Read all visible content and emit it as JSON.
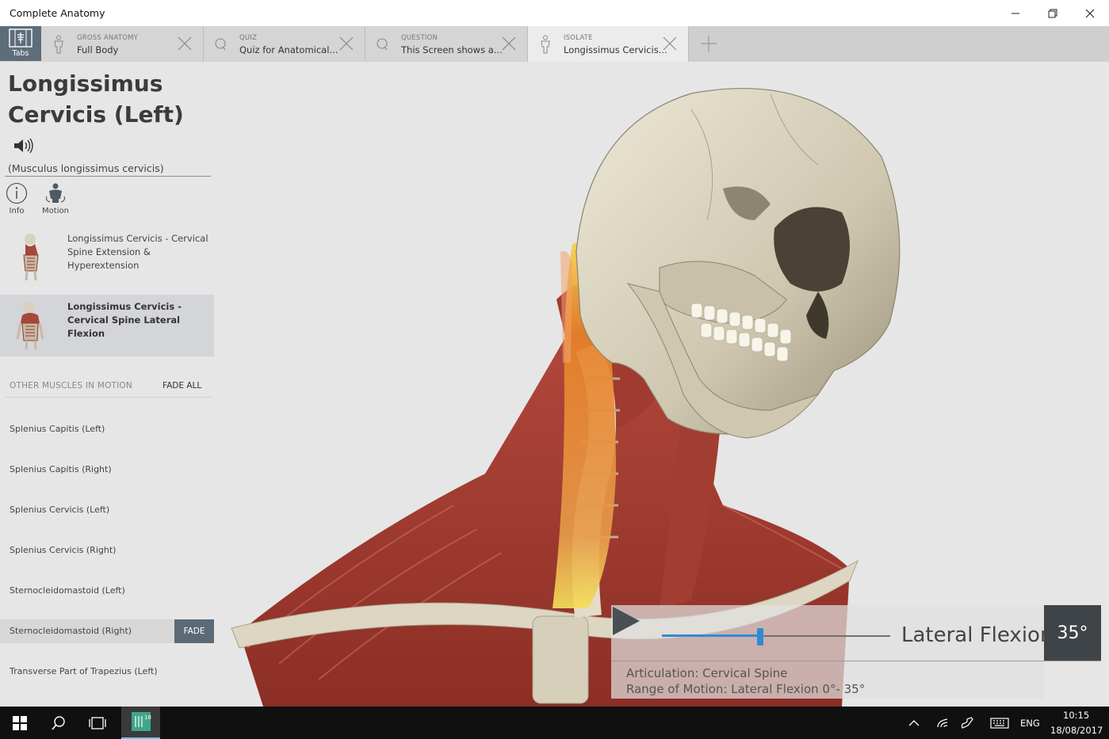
{
  "window": {
    "title": "Complete Anatomy"
  },
  "tabstrip": {
    "tabs_button_label": "Tabs",
    "tabs": [
      {
        "kind": "GROSS ANATOMY",
        "name": "Full Body",
        "icon": "person-icon",
        "active": false
      },
      {
        "kind": "QUIZ",
        "name": "Quiz for Anatomical...",
        "icon": "quiz-icon",
        "active": false
      },
      {
        "kind": "QUESTION",
        "name": "This Screen shows a...",
        "icon": "quiz-icon",
        "active": false
      },
      {
        "kind": "ISOLATE",
        "name": "Longissimus Cervicis...",
        "icon": "person-icon",
        "active": true
      }
    ]
  },
  "panel": {
    "title": "Longissimus Cervicis (Left)",
    "latin_name": "(Musculus longissimus cervicis)",
    "modes": [
      {
        "label": "Info",
        "icon": "info-icon"
      },
      {
        "label": "Motion",
        "icon": "motion-icon"
      }
    ],
    "motions": [
      {
        "label": "Longissimus Cervicis - Cervical Spine Extension & Hyperextension",
        "selected": false
      },
      {
        "label": "Longissimus Cervicis - Cervical Spine Lateral Flexion",
        "selected": true
      }
    ],
    "other_header": "OTHER MUSCLES IN MOTION",
    "fade_all_label": "FADE ALL",
    "fade_label": "FADE",
    "other_muscles": [
      "Splenius Capitis (Left)",
      "Splenius Capitis (Right)",
      "Splenius Cervicis (Left)",
      "Splenius Cervicis (Right)",
      "Sternocleidomastoid (Left)",
      "Sternocleidomastoid (Right)",
      "Transverse Part of Trapezius (Left)"
    ],
    "highlighted_muscle_index": 5
  },
  "motion_controls": {
    "motion_label": "Lateral Flexion:",
    "angle_value": "35°",
    "slider_fraction": 0.43,
    "articulation_line": "Articulation:   Cervical Spine",
    "range_line": "Range of Motion:   Lateral Flexion 0°- 35°"
  },
  "taskbar": {
    "language": "ENG",
    "time": "10:15",
    "date": "18/08/2017",
    "app_badge": "18"
  },
  "colors": {
    "accent": "#2f8bd4",
    "tab_button": "#5d6d7a",
    "muscle_red": "#a8362c",
    "bone": "#d9d3bf",
    "highlight_orange": "#e8822a"
  }
}
